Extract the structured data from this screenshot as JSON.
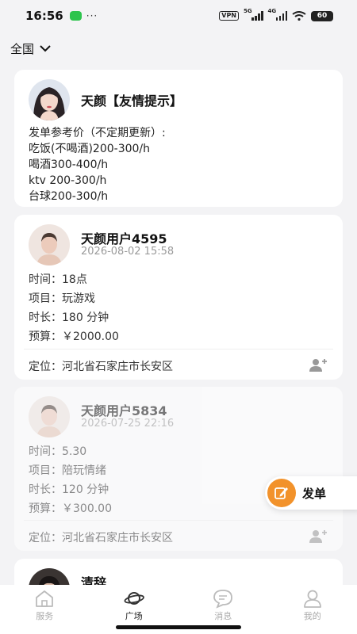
{
  "status_bar": {
    "time": "16:56",
    "dots": "···",
    "vpn": "VPN",
    "sig1": "5G",
    "sig2": "4G",
    "battery": "60"
  },
  "region": {
    "label": "全国"
  },
  "pinned": {
    "name": "天颜【友情提示】",
    "lines": [
      "发单参考价（不定期更新）:",
      "吃饭(不喝酒)200-300/h",
      "喝酒300-400/h",
      "ktv 200-300/h",
      "台球200-300/h"
    ]
  },
  "posts": [
    {
      "name": "天颜用户4595",
      "time": "2026-08-02 15:58",
      "fields": [
        "时间：18点",
        "项目：玩游戏",
        "时长：180 分钟",
        "预算：￥2000.00"
      ],
      "location": "定位：河北省石家庄市长安区"
    },
    {
      "name": "天颜用户5834",
      "time": "2026-07-25 22:16",
      "fields": [
        "时间：5.30",
        "项目：陪玩情绪",
        "时长：120 分钟",
        "预算：￥300.00"
      ],
      "location": "定位：河北省石家庄市长安区"
    },
    {
      "name": "清辞"
    }
  ],
  "fab": {
    "label": "发单",
    "accent": "#f2922b"
  },
  "tabs": [
    {
      "label": "服务",
      "icon": "home-icon"
    },
    {
      "label": "广场",
      "icon": "planet-icon",
      "active": true
    },
    {
      "label": "消息",
      "icon": "message-icon"
    },
    {
      "label": "我的",
      "icon": "user-icon"
    }
  ]
}
